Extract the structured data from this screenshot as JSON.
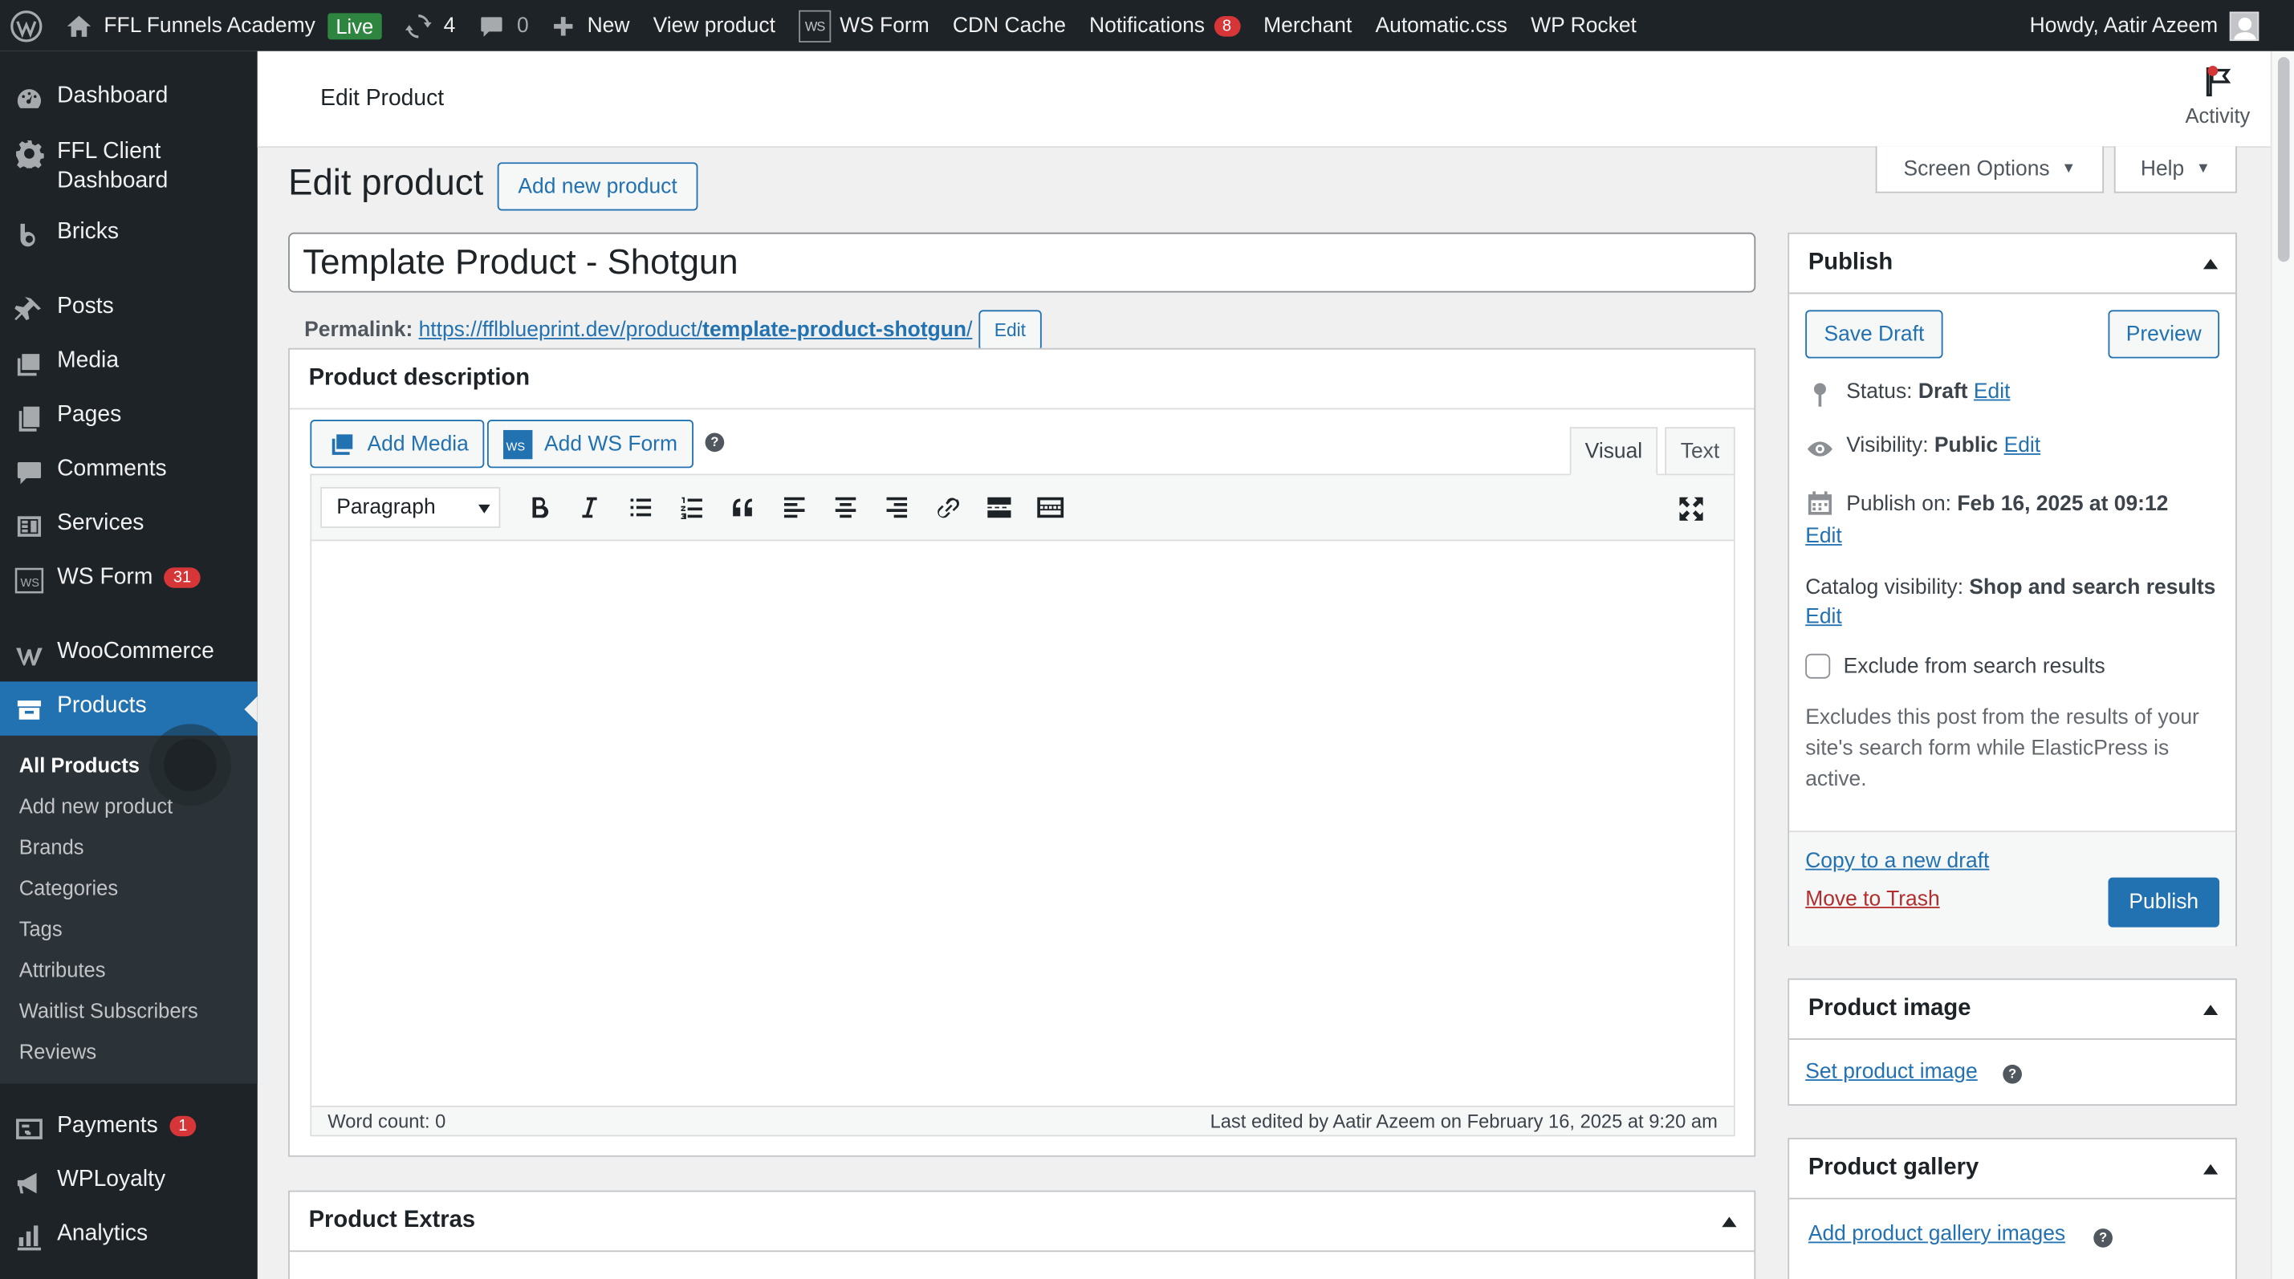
{
  "adminbar": {
    "site_name": "FFL Funnels Academy",
    "live": "Live",
    "updates": "4",
    "comments": "0",
    "new": "New",
    "view_product": "View product",
    "ws_form": "WS Form",
    "cdn_cache": "CDN Cache",
    "notifications": "Notifications",
    "notifications_count": "8",
    "merchant": "Merchant",
    "automatic_css": "Automatic.css",
    "wp_rocket": "WP Rocket",
    "howdy": "Howdy, Aatir Azeem",
    "ws_logo": "WS"
  },
  "sidebar": {
    "dashboard": "Dashboard",
    "ffl_client": "FFL Client Dashboard",
    "bricks": "Bricks",
    "posts": "Posts",
    "media": "Media",
    "pages": "Pages",
    "comments": "Comments",
    "services": "Services",
    "ws_form": "WS Form",
    "ws_form_count": "31",
    "woocommerce": "WooCommerce",
    "products": "Products",
    "submenu": {
      "all_products": "All Products",
      "add_new": "Add new product",
      "brands": "Brands",
      "categories": "Categories",
      "tags": "Tags",
      "attributes": "Attributes",
      "waitlist": "Waitlist Subscribers",
      "reviews": "Reviews"
    },
    "payments": "Payments",
    "payments_count": "1",
    "wployalty": "WPLoyalty",
    "analytics": "Analytics"
  },
  "header": {
    "title": "Edit Product",
    "activity": "Activity",
    "screen_options": "Screen Options",
    "help": "Help"
  },
  "page": {
    "heading": "Edit product",
    "add_new": "Add new product",
    "product_title": "Template Product - Shotgun",
    "permalink_label": "Permalink:",
    "permalink_base": "https://fflblueprint.dev/product/",
    "permalink_slug": "template-product-shotgun",
    "permalink_end": "/",
    "permalink_edit": "Edit"
  },
  "description": {
    "header": "Product description",
    "add_media": "Add Media",
    "add_ws_form": "Add WS Form",
    "help": "?",
    "tab_visual": "Visual",
    "tab_text": "Text",
    "format": "Paragraph",
    "word_count": "Word count: 0",
    "last_edited": "Last edited by Aatir Azeem on February 16, 2025 at 9:20 am"
  },
  "extras": {
    "header": "Product Extras"
  },
  "publish": {
    "header": "Publish",
    "save_draft": "Save Draft",
    "preview": "Preview",
    "status_label": "Status:",
    "status_value": "Draft",
    "visibility_label": "Visibility:",
    "visibility_value": "Public",
    "publish_on_label": "Publish on:",
    "publish_on_value": "Feb 16, 2025 at 09:12",
    "catalog_label": "Catalog visibility:",
    "catalog_value": "Shop and search results",
    "edit": "Edit",
    "exclude_label": "Exclude from search results",
    "exclude_desc": "Excludes this post from the results of your site's search form while ElasticPress is active.",
    "copy_draft": "Copy to a new draft",
    "trash": "Move to Trash",
    "publish_btn": "Publish"
  },
  "product_image": {
    "header": "Product image",
    "set_image": "Set product image",
    "help": "?"
  },
  "product_gallery": {
    "header": "Product gallery",
    "add_images": "Add product gallery images",
    "help": "?"
  },
  "colors": {
    "admin_dark": "#1d2327",
    "accent": "#2271b1",
    "badge": "#d63638",
    "live": "#2e8540",
    "trash": "#b32d2e"
  }
}
